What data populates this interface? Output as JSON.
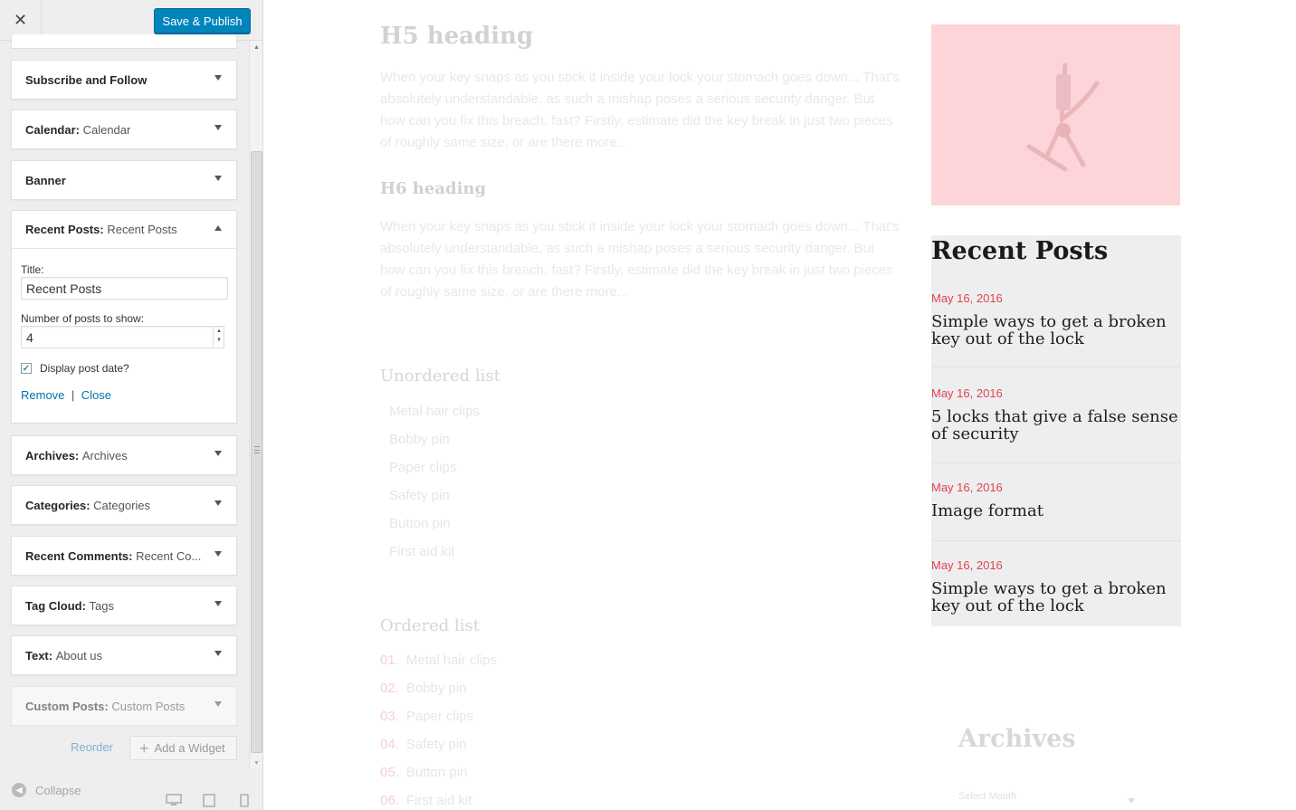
{
  "header": {
    "close_icon": "close-icon",
    "publish_label": "Save & Publish"
  },
  "widgets": [
    {
      "name": "Subscribe and Follow",
      "title": ""
    },
    {
      "name": "Calendar",
      "title": "Calendar"
    },
    {
      "name": "Banner",
      "title": ""
    },
    {
      "name": "Recent Posts",
      "title": "Recent Posts",
      "expanded": true
    },
    {
      "name": "Archives",
      "title": "Archives"
    },
    {
      "name": "Categories",
      "title": "Categories"
    },
    {
      "name": "Recent Comments",
      "title": "Recent Co..."
    },
    {
      "name": "Tag Cloud",
      "title": "Tags"
    },
    {
      "name": "Text",
      "title": "About us"
    },
    {
      "name": "Custom Posts",
      "title": "Custom Posts"
    }
  ],
  "recent_posts_form": {
    "title_label": "Title:",
    "title_value": "Recent Posts",
    "count_label": "Number of posts to show:",
    "count_value": "4",
    "show_date_label": "Display post date?",
    "show_date_checked": true,
    "remove_label": "Remove",
    "separator": "|",
    "close_label": "Close"
  },
  "sidebar_actions": {
    "reorder_label": "Reorder",
    "add_widget_label": "Add a Widget"
  },
  "footer": {
    "collapse_label": "Collapse"
  },
  "preview": {
    "h5": "H5 heading",
    "h5_paragraph": "When your key snaps as you stick it inside your lock your stomach goes down... That's absolutely understandable, as such a mishap poses a serious security danger. But how can you fix this breach, fast? Firstly, estimate did the key break in just two pieces of roughly same size, or are there more...",
    "h6": "H6 heading",
    "h6_paragraph": "When your key snaps as you stick it inside your lock your stomach goes down... That's absolutely understandable, as such a mishap poses a serious security danger. But how can you fix this breach, fast? Firstly, estimate did the key break in just two pieces of roughly same size, or are there more...",
    "unordered_title": "Unordered list",
    "unordered_items": [
      "Metal hair clips",
      "Bobby pin",
      "Paper clips",
      "Safety pin",
      "Button pin",
      "First aid kit"
    ],
    "ordered_title": "Ordered list",
    "ordered_items": [
      {
        "num": "01.",
        "text": "Metal hair clips"
      },
      {
        "num": "02.",
        "text": "Bobby pin"
      },
      {
        "num": "03.",
        "text": "Paper clips"
      },
      {
        "num": "04.",
        "text": "Safety pin"
      },
      {
        "num": "05.",
        "text": "Button pin"
      },
      {
        "num": "06.",
        "text": "First aid kit"
      }
    ],
    "recent_posts": {
      "title": "Recent Posts",
      "posts": [
        {
          "date": "May 16, 2016",
          "title": "Simple ways to get a broken key out of the lock"
        },
        {
          "date": "May 16, 2016",
          "title": "5 locks that give a false sense of security"
        },
        {
          "date": "May 16, 2016",
          "title": "Image format"
        },
        {
          "date": "May 16, 2016",
          "title": "Simple ways to get a broken key out of the lock"
        }
      ]
    },
    "archives_title": "Archives",
    "archives_select": "Select Month"
  },
  "colors": {
    "primary_button": "#0085ba",
    "link": "#0073aa",
    "date_accent": "#e0434f",
    "featured_bg": "#fdd4d8"
  }
}
